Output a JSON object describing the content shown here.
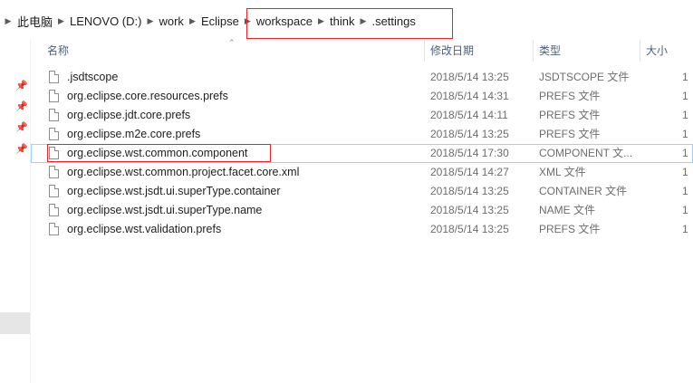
{
  "breadcrumb": {
    "items": [
      "此电脑",
      "LENOVO (D:)",
      "work",
      "Eclipse",
      "workspace",
      "think",
      ".settings"
    ]
  },
  "columns": {
    "name": "名称",
    "date": "修改日期",
    "type": "类型",
    "size": "大小"
  },
  "files": [
    {
      "name": ".jsdtscope",
      "date": "2018/5/14 13:25",
      "type": "JSDTSCOPE 文件",
      "size": "1"
    },
    {
      "name": "org.eclipse.core.resources.prefs",
      "date": "2018/5/14 14:31",
      "type": "PREFS 文件",
      "size": "1"
    },
    {
      "name": "org.eclipse.jdt.core.prefs",
      "date": "2018/5/14 14:11",
      "type": "PREFS 文件",
      "size": "1"
    },
    {
      "name": "org.eclipse.m2e.core.prefs",
      "date": "2018/5/14 13:25",
      "type": "PREFS 文件",
      "size": "1"
    },
    {
      "name": "org.eclipse.wst.common.component",
      "date": "2018/5/14 17:30",
      "type": "COMPONENT 文...",
      "size": "1"
    },
    {
      "name": "org.eclipse.wst.common.project.facet.core.xml",
      "date": "2018/5/14 14:27",
      "type": "XML 文件",
      "size": "1"
    },
    {
      "name": "org.eclipse.wst.jsdt.ui.superType.container",
      "date": "2018/5/14 13:25",
      "type": "CONTAINER 文件",
      "size": "1"
    },
    {
      "name": "org.eclipse.wst.jsdt.ui.superType.name",
      "date": "2018/5/14 13:25",
      "type": "NAME 文件",
      "size": "1"
    },
    {
      "name": "org.eclipse.wst.validation.prefs",
      "date": "2018/5/14 13:25",
      "type": "PREFS 文件",
      "size": "1"
    }
  ],
  "icons": {
    "pin": "pin-icon",
    "file": "file-icon",
    "separator": "chevron-right-icon",
    "sort": "sort-up-icon"
  },
  "colors": {
    "highlight": "#e6262c",
    "header_text": "#4c607a",
    "selection_border": "#99d1ff"
  }
}
